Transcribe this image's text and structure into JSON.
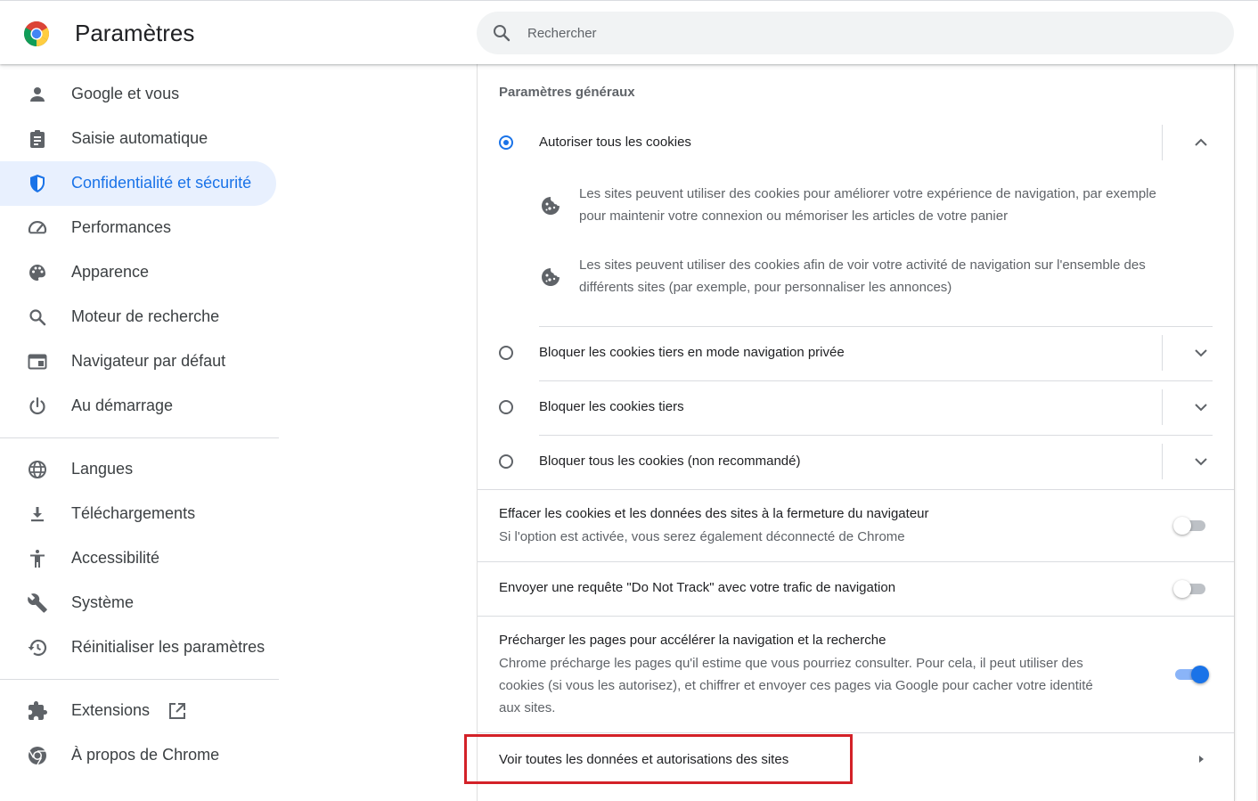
{
  "header": {
    "title": "Paramètres",
    "search_placeholder": "Rechercher"
  },
  "sidebar": {
    "items": [
      {
        "label": "Google et vous",
        "icon": "person-icon"
      },
      {
        "label": "Saisie automatique",
        "icon": "clipboard-icon"
      },
      {
        "label": "Confidentialité et sécurité",
        "icon": "shield-icon",
        "active": true
      },
      {
        "label": "Performances",
        "icon": "speedometer-icon"
      },
      {
        "label": "Apparence",
        "icon": "palette-icon"
      },
      {
        "label": "Moteur de recherche",
        "icon": "search-icon"
      },
      {
        "label": "Navigateur par défaut",
        "icon": "browser-window-icon"
      },
      {
        "label": "Au démarrage",
        "icon": "power-icon"
      }
    ],
    "advanced_items": [
      {
        "label": "Langues",
        "icon": "globe-icon"
      },
      {
        "label": "Téléchargements",
        "icon": "download-icon"
      },
      {
        "label": "Accessibilité",
        "icon": "accessibility-icon"
      },
      {
        "label": "Système",
        "icon": "wrench-icon"
      },
      {
        "label": "Réinitialiser les paramètres",
        "icon": "history-icon"
      }
    ],
    "footer_items": [
      {
        "label": "Extensions",
        "icon": "puzzle-icon",
        "external_link_icon": "open-in-new-icon"
      },
      {
        "label": "À propos de Chrome",
        "icon": "chrome-icon"
      }
    ]
  },
  "main": {
    "section_title": "Paramètres généraux",
    "cookie_options": [
      {
        "label": "Autoriser tous les cookies",
        "checked": true,
        "expanded": true
      },
      {
        "label": "Bloquer les cookies tiers en mode navigation privée",
        "checked": false,
        "expanded": false
      },
      {
        "label": "Bloquer les cookies tiers",
        "checked": false,
        "expanded": false
      },
      {
        "label": "Bloquer tous les cookies (non recommandé)",
        "checked": false,
        "expanded": false
      }
    ],
    "expanded_details": [
      {
        "line1": "Les sites peuvent utiliser des cookies pour améliorer votre expérience de navigation, par exemple",
        "line2": "pour maintenir votre connexion ou mémoriser les articles de votre panier"
      },
      {
        "line1": "Les sites peuvent utiliser des cookies afin de voir votre activité de navigation sur l'ensemble des",
        "line2": "différents sites (par exemple, pour personnaliser les annonces)"
      }
    ],
    "toggles": [
      {
        "title": "Effacer les cookies et les données des sites à la fermeture du navigateur",
        "subtitle": "Si l'option est activée, vous serez également déconnecté de Chrome",
        "on": false
      },
      {
        "title": "Envoyer une requête \"Do Not Track\" avec votre trafic de navigation",
        "on": false
      },
      {
        "title": "Précharger les pages pour accélérer la navigation et la recherche",
        "subtitle_lines": [
          "Chrome précharge les pages qu'il estime que vous pourriez consulter. Pour cela, il peut utiliser des",
          "cookies (si vous les autorisez), et chiffrer et envoyer ces pages via Google pour cacher votre identité",
          "aux sites."
        ],
        "on": true
      }
    ],
    "site_data_link": "Voir toutes les données et autorisations des sites"
  },
  "colors": {
    "accent": "#1a73e8",
    "active_nav_bg": "#e8f0fe",
    "highlight_border": "#d32128"
  }
}
